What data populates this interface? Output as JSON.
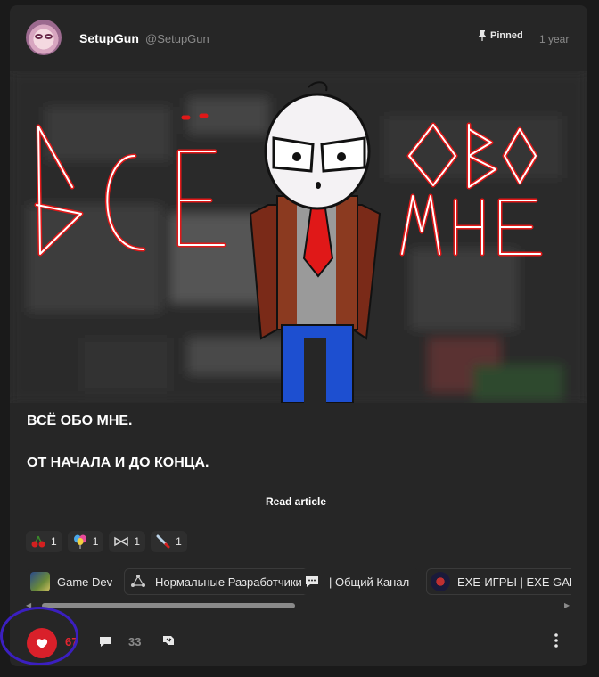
{
  "post": {
    "author_name": "SetupGun",
    "author_handle": "@SetupGun",
    "pinned_label": "Pinned",
    "time": "1 year",
    "banner_title_left": "ВСЁ",
    "banner_title_right_top": "ОБО",
    "banner_title_right_bottom": "МНЕ",
    "text_line_1": "ВСЁ ОБО МНЕ.",
    "text_line_2": "ОТ НАЧАЛА И ДО КОНЦА.",
    "read_article": "Read article"
  },
  "reactions": [
    {
      "icon": "cherries-icon",
      "count": "1"
    },
    {
      "icon": "balloons-icon",
      "count": "1"
    },
    {
      "icon": "ribbon-icon",
      "count": "1"
    },
    {
      "icon": "knife-icon",
      "count": "1"
    }
  ],
  "channels": [
    {
      "label": "Game Dev",
      "icon": "game-dev-avatar"
    },
    {
      "label": "Нормальные Разработчики",
      "icon": "network-icon"
    },
    {
      "label": "| Общий Канал",
      "icon": "chat-icon"
    },
    {
      "label": "EXE-ИГРЫ | EXE GAM",
      "icon": "exe-avatar"
    }
  ],
  "footer": {
    "like_count": "67",
    "comment_count": "33"
  },
  "colors": {
    "background": "#1a1a1a",
    "card": "#262626",
    "like": "#d9202a",
    "annotation": "#3b1fc0"
  }
}
